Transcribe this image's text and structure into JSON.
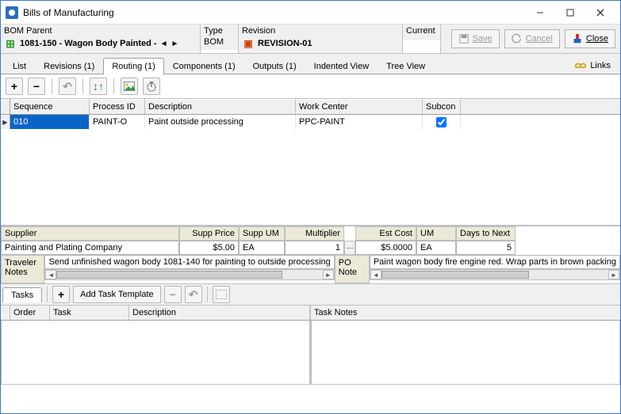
{
  "window": {
    "title": "Bills of Manufacturing"
  },
  "header": {
    "bom_parent_label": "BOM Parent",
    "parent_value": "1081-150 - Wagon Body Painted - ",
    "type_label": "Type",
    "type_value": "BOM",
    "revision_label": "Revision",
    "revision_value": "REVISION-01",
    "current_label": "Current",
    "save_label": "Save",
    "cancel_label": "Cancel",
    "close_label": "Close"
  },
  "tabs": {
    "list": "List",
    "revisions": "Revisions (1)",
    "routing": "Routing (1)",
    "components": "Components (1)",
    "outputs": "Outputs (1)",
    "indented": "Indented View",
    "tree": "Tree View",
    "links": "Links"
  },
  "grid": {
    "cols": {
      "sequence": "Sequence",
      "process_id": "Process ID",
      "description": "Description",
      "work_center": "Work Center",
      "subcon": "Subcon"
    },
    "rows": [
      {
        "sequence": "010",
        "process_id": "PAINT-O",
        "description": "Paint outside processing",
        "work_center": "PPC-PAINT",
        "subcon": true
      }
    ]
  },
  "details": {
    "supplier_label": "Supplier",
    "supplier_value": "Painting and Plating Company",
    "supp_price_label": "Supp Price",
    "supp_price_value": "$5.00",
    "supp_um_label": "Supp UM",
    "supp_um_value": "EA",
    "multiplier_label": "Multiplier",
    "multiplier_value": "1",
    "est_cost_label": "Est Cost",
    "est_cost_value": "$5.0000",
    "um_label": "UM",
    "um_value": "EA",
    "days_next_label": "Days to Next",
    "days_next_value": "5",
    "traveler_notes_label": "Traveler Notes",
    "traveler_notes_value": "Send unfinished wagon body 1081-140 for painting to outside processing",
    "po_note_label": "PO Note",
    "po_note_value": "Paint wagon body fire engine red.  Wrap parts in brown packing"
  },
  "tasks": {
    "tab": "Tasks",
    "add_template": "Add Task Template",
    "cols": {
      "order": "Order",
      "task": "Task",
      "description": "Description"
    },
    "task_notes": "Task Notes",
    "rows": []
  }
}
